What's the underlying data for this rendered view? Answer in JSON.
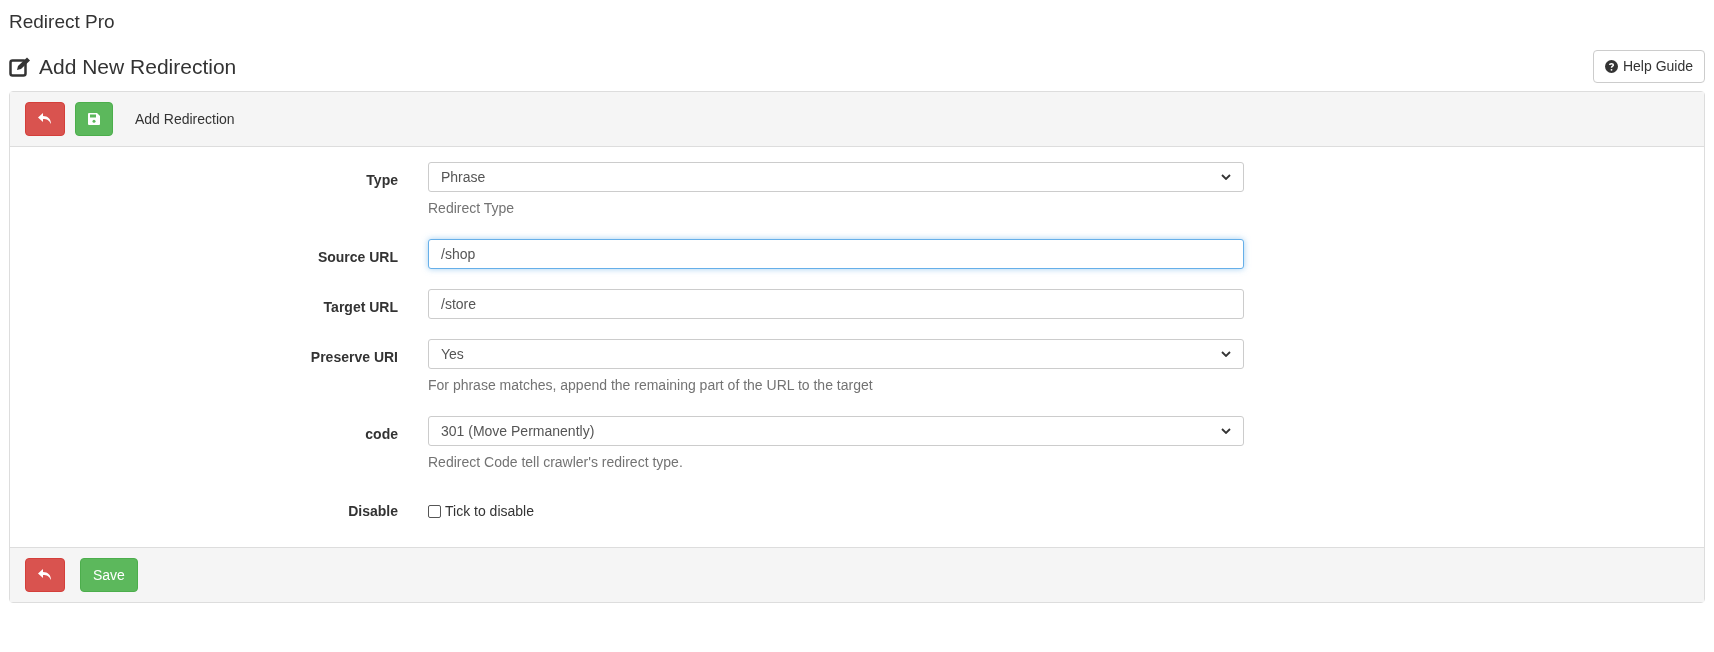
{
  "page_title": "Redirect Pro",
  "heading": "Add New Redirection",
  "help_button": "Help Guide",
  "panel_title": "Add Redirection",
  "fields": [
    {
      "kind": "select",
      "label": "Type",
      "value": "Phrase",
      "help": "Redirect Type",
      "focused": false
    },
    {
      "kind": "input",
      "label": "Source URL",
      "value": "/shop",
      "focused": true
    },
    {
      "kind": "input",
      "label": "Target URL",
      "value": "/store",
      "focused": false
    },
    {
      "kind": "select",
      "label": "Preserve URI",
      "value": "Yes",
      "help": "For phrase matches, append the remaining part of the URL to the target",
      "focused": false
    },
    {
      "kind": "select",
      "label": "code",
      "value": "301 (Move Permanently)",
      "help": "Redirect Code tell crawler's redirect type.",
      "focused": false
    },
    {
      "kind": "checkbox",
      "label": "Disable",
      "text": "Tick to disable",
      "checked": false
    }
  ],
  "footer": {
    "save_button": "Save"
  }
}
